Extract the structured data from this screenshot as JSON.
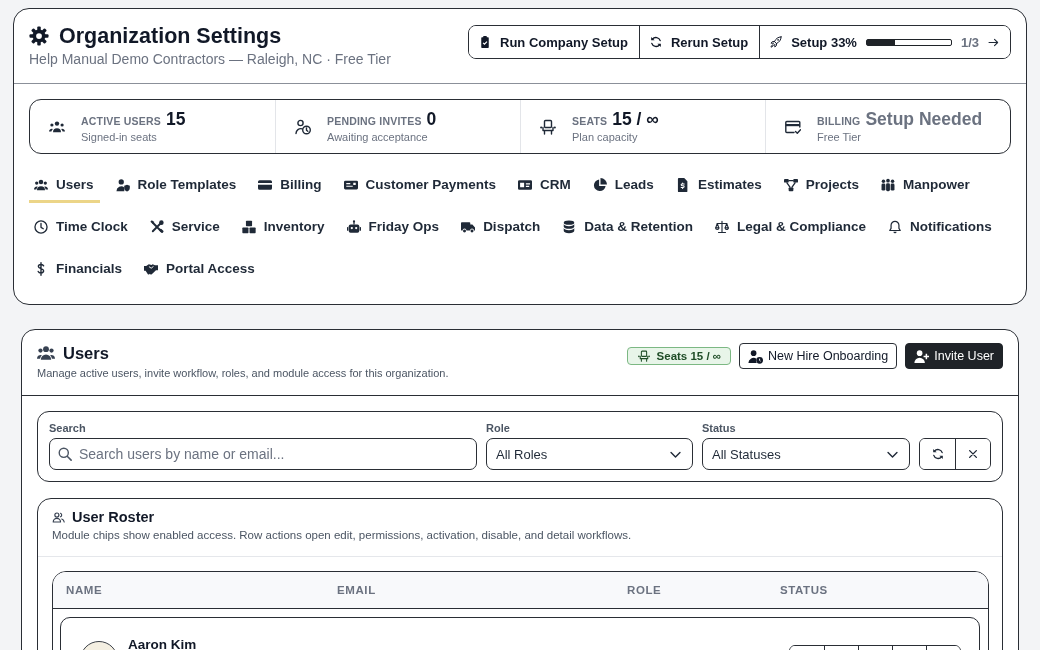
{
  "header": {
    "title": "Organization Settings",
    "subtitle": "Help Manual Demo Contractors — Raleigh, NC · Free Tier"
  },
  "setup_actions": [
    {
      "kind": "button",
      "label": "Run Company Setup"
    },
    {
      "kind": "button",
      "label": "Rerun Setup"
    },
    {
      "kind": "progress",
      "label": "Setup 33%",
      "level": 0.33,
      "reading": "1/3"
    }
  ],
  "stats": [
    {
      "label": "ACTIVE USERS",
      "value": "15",
      "caption": "Signed-in seats",
      "muted": false
    },
    {
      "label": "PENDING INVITES",
      "value": "0",
      "caption": "Awaiting acceptance",
      "muted": false
    },
    {
      "label": "SEATS",
      "value": "15 / ∞",
      "caption": "Plan capacity",
      "muted": false
    },
    {
      "label": "BILLING",
      "value": "Setup Needed",
      "caption": "Free Tier",
      "muted": true
    }
  ],
  "tabs": [
    {
      "label": "Users",
      "selected": true
    },
    {
      "label": "Role Templates",
      "selected": false
    },
    {
      "label": "Billing",
      "selected": false
    },
    {
      "label": "Customer Payments",
      "selected": false
    },
    {
      "label": "CRM",
      "selected": false
    },
    {
      "label": "Leads",
      "selected": false
    },
    {
      "label": "Estimates",
      "selected": false
    },
    {
      "label": "Projects",
      "selected": false
    },
    {
      "label": "Manpower",
      "selected": false
    },
    {
      "label": "Time Clock",
      "selected": false
    },
    {
      "label": "Service",
      "selected": false
    },
    {
      "label": "Inventory",
      "selected": false
    },
    {
      "label": "Friday Ops",
      "selected": false
    },
    {
      "label": "Dispatch",
      "selected": false
    },
    {
      "label": "Data & Retention",
      "selected": false
    },
    {
      "label": "Legal & Compliance",
      "selected": false
    },
    {
      "label": "Notifications",
      "selected": false
    },
    {
      "label": "Financials",
      "selected": false
    },
    {
      "label": "Portal Access",
      "selected": false
    }
  ],
  "users_panel": {
    "title": "Users",
    "subtitle": "Manage active users, invite workflow, roles, and module access for this organization.",
    "seats_badge": "Seats 15 / ∞",
    "buttons": [
      {
        "kind": "outline",
        "label": "New Hire Onboarding"
      },
      {
        "kind": "primary",
        "label": "Invite User"
      }
    ],
    "filters": {
      "search": {
        "label": "Search",
        "placeholder": "Search users by name or email..."
      },
      "role": {
        "label": "Role",
        "value": "All Roles"
      },
      "status": {
        "label": "Status",
        "value": "All Statuses"
      }
    },
    "roster": {
      "title": "User Roster",
      "subtitle": "Module chips show enabled access. Row actions open edit, permissions, activation, disable, and detail workflows.",
      "columns": [
        "NAME",
        "EMAIL",
        "ROLE",
        "STATUS"
      ],
      "rows": [
        {
          "name": "Aaron Kim"
        }
      ]
    }
  }
}
